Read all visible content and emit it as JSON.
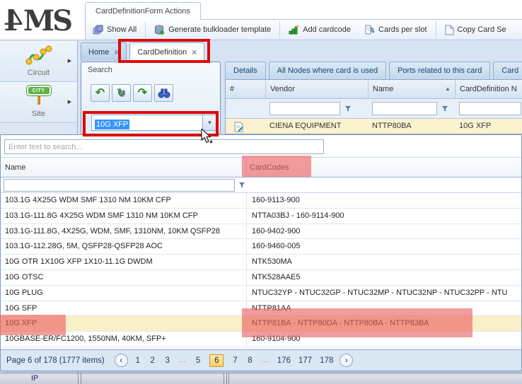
{
  "app": {
    "logo": "4MS"
  },
  "ribbon": {
    "tab_label": "CardDefinitionForm Actions",
    "buttons": [
      "Show All",
      "Generate bulkloader template",
      "Add cardcode",
      "Cards per slot",
      "Copy Card Se"
    ]
  },
  "sidebar": {
    "items": [
      {
        "label": "Circuit"
      },
      {
        "label": "Site"
      }
    ]
  },
  "doc_tabs": [
    {
      "label": "Home"
    },
    {
      "label": "CardDefinition"
    }
  ],
  "search_panel": {
    "title": "Search",
    "combo_value": "10G XFP"
  },
  "details_panel": {
    "tabs": [
      "Details",
      "All Nodes where card is used",
      "Ports related to this card",
      "Card"
    ],
    "columns": [
      "#",
      "Vendor",
      "Name",
      "CardDefinition N"
    ],
    "row": {
      "vendor": "CIENA EQUIPMENT",
      "name": "NTTP80BA",
      "carddefinition": "10G XFP"
    }
  },
  "dropdown": {
    "search_placeholder": "Enter text to search...",
    "columns": {
      "name": "Name",
      "codes": "CardCodes"
    },
    "rows": [
      {
        "name": "103.1G 4X25G WDM SMF 1310 NM 10KM CFP",
        "codes": "160-9113-900"
      },
      {
        "name": "103.1G-111.8G 4X25G WDM SMF 1310 NM 10KM CFP",
        "codes": "NTTA03BJ - 160-9114-900"
      },
      {
        "name": "103.1G-111.8G, 4X25G, WDM, SMF, 1310NM, 10KM QSFP28",
        "codes": "160-9402-900"
      },
      {
        "name": "103.1G-112.28G, 5M, QSFP28-QSFP28 AOC",
        "codes": "160-9460-005"
      },
      {
        "name": "10G OTR 1X10G XFP 1X10-11.1G DWDM",
        "codes": "NTK530MA"
      },
      {
        "name": "10G OTSC",
        "codes": "NTK528AAE5"
      },
      {
        "name": "10G PLUG",
        "codes": "NTUC32YP - NTUC32GP - NTUC32MP - NTUC32NP - NTUC32PP - NTU"
      },
      {
        "name": "10G SFP",
        "codes": "NTTP81AA"
      },
      {
        "name": "10G XFP",
        "codes": "NTTP81BA - NTTP80DA - NTTP80BA - NTTP83BA",
        "selected": true
      },
      {
        "name": "10GBASE-ER/FC1200, 1550NM, 40KM, SFP+",
        "codes": "160-9104-900"
      }
    ],
    "pager": {
      "summary": "Page 6 of 178 (1777 items)",
      "prev": "‹",
      "next": "›",
      "pages": [
        "1",
        "2",
        "3",
        "...",
        "5",
        "6",
        "7",
        "8",
        "...",
        "176",
        "177",
        "178"
      ],
      "current": "6"
    }
  },
  "bottom_strip": {
    "label": "IP"
  },
  "colors": {
    "annotation_red": "#dd0a0a",
    "annotation_fill": "#ec5f5f",
    "selection_blue": "#3595ff",
    "selected_row_bg": "#faf0c8",
    "pager_current_bg": "#f6cf6a",
    "pager_current_border": "#d0952e",
    "main_bg": "#d7e3f2"
  }
}
